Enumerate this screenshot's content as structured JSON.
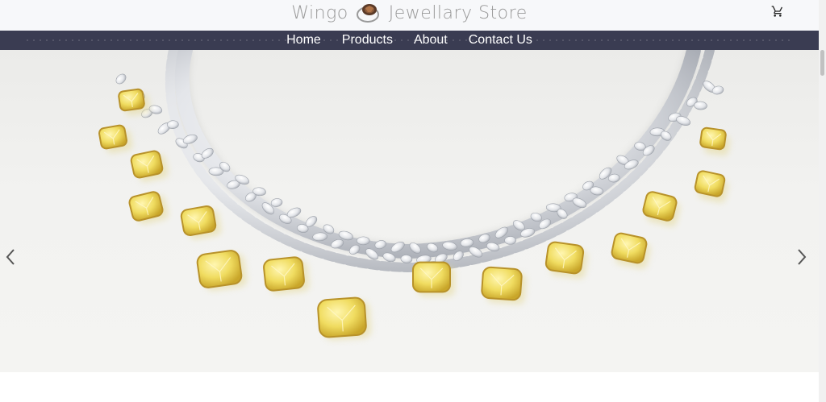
{
  "header": {
    "brand_left": "Wingo",
    "brand_right": "Jewellary Store",
    "logo_icon": "diamond-ring-logo",
    "cart_icon": "shopping-cart-icon"
  },
  "nav": {
    "items": [
      {
        "label": "Home"
      },
      {
        "label": "Products"
      },
      {
        "label": "About"
      },
      {
        "label": "Contact Us"
      }
    ]
  },
  "carousel": {
    "slide_image": "diamond-necklace-photo",
    "prev_icon": "chevron-left-icon",
    "next_icon": "chevron-right-icon"
  },
  "colors": {
    "nav_bg": "#3a3c52",
    "header_bg": "#f7f8fa",
    "brand_text": "#8a8a8a",
    "gem_yellow": "#f2df6a",
    "gold": "#d6b23a"
  }
}
